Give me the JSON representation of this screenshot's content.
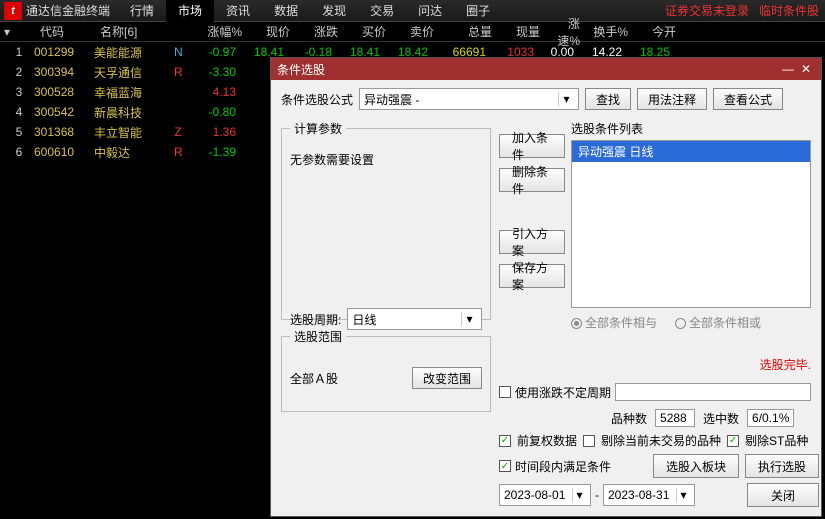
{
  "app": {
    "name": "通达信金融终端",
    "logo_glyph": "t"
  },
  "menu": [
    "行情",
    "市场",
    "资讯",
    "数据",
    "发现",
    "交易",
    "问达",
    "圈子"
  ],
  "menu_active_index": 1,
  "top_alerts": [
    "证券交易未登录",
    "临时条件股"
  ],
  "columns": [
    "代码",
    "名称[6]",
    "涨幅%",
    "现价",
    "涨跌",
    "买价",
    "卖价",
    "总量",
    "现量",
    "涨速%",
    "换手%",
    "今开"
  ],
  "rows": [
    {
      "idx": "1",
      "code": "001299",
      "name": "美能能源",
      "flag": "N",
      "pct": "-0.97",
      "price": "18.41",
      "chg": "-0.18",
      "bid": "18.41",
      "ask": "18.42",
      "tvol": "66691",
      "cvol": "1033",
      "spd": "0.00",
      "turn": "14.22",
      "open": "18.25"
    },
    {
      "idx": "2",
      "code": "300394",
      "name": "天孚通信",
      "flag": "R",
      "pct": "-3.30",
      "price": "",
      "chg": "",
      "bid": "",
      "ask": "",
      "tvol": "",
      "cvol": "",
      "spd": "",
      "turn": "",
      "open": ""
    },
    {
      "idx": "3",
      "code": "300528",
      "name": "幸福蓝海",
      "flag": "",
      "pct": "4.13",
      "price": "",
      "chg": "",
      "bid": "",
      "ask": "",
      "tvol": "",
      "cvol": "",
      "spd": "",
      "turn": "",
      "open": ""
    },
    {
      "idx": "4",
      "code": "300542",
      "name": "新晨科技",
      "flag": "",
      "pct": "-0.80",
      "price": "",
      "chg": "",
      "bid": "",
      "ask": "",
      "tvol": "",
      "cvol": "",
      "spd": "",
      "turn": "",
      "open": ""
    },
    {
      "idx": "5",
      "code": "301368",
      "name": "丰立智能",
      "flag": "Z",
      "pct": "1.36",
      "price": "",
      "chg": "",
      "bid": "",
      "ask": "",
      "tvol": "",
      "cvol": "",
      "spd": "",
      "turn": "",
      "open": ""
    },
    {
      "idx": "6",
      "code": "600610",
      "name": "中毅达",
      "flag": "R",
      "pct": "-1.39",
      "price": "",
      "chg": "",
      "bid": "",
      "ask": "",
      "tvol": "",
      "cvol": "",
      "spd": "",
      "turn": "",
      "open": ""
    }
  ],
  "dialog": {
    "title": "条件选股",
    "formula_label": "条件选股公式",
    "formula_value": "异动强震    -",
    "find_btn": "查找",
    "usage_btn": "用法注释",
    "view_formula_btn": "查看公式",
    "params_legend": "计算参数",
    "params_empty": "无参数需要设置",
    "period_label": "选股周期:",
    "period_value": "日线",
    "range_legend": "选股范围",
    "range_value": "全部Ａ股",
    "change_range_btn": "改变范围",
    "add_cond_btn": "加入条件",
    "del_cond_btn": "删除条件",
    "import_btn": "引入方案",
    "save_btn": "保存方案",
    "list_legend": "选股条件列表",
    "list_item": "异动强震  日线",
    "radio_and": "全部条件相与",
    "radio_or": "全部条件相或",
    "status": "选股完毕.",
    "use_undef_period": "使用涨跌不定周期",
    "count_label": "品种数",
    "count_value": "5288",
    "hit_label": "选中数",
    "hit_value": "6/0.1%",
    "pre_adj": "前复权数据",
    "del_nontrade": "剔除当前未交易的品种",
    "del_st": "剔除ST品种",
    "time_cond": "时间段内满足条件",
    "into_block_btn": "选股入板块",
    "exec_btn": "执行选股",
    "date_from": "2023-08-01",
    "date_to": "2023-08-31",
    "close_btn": "关闭",
    "dash": "-"
  }
}
